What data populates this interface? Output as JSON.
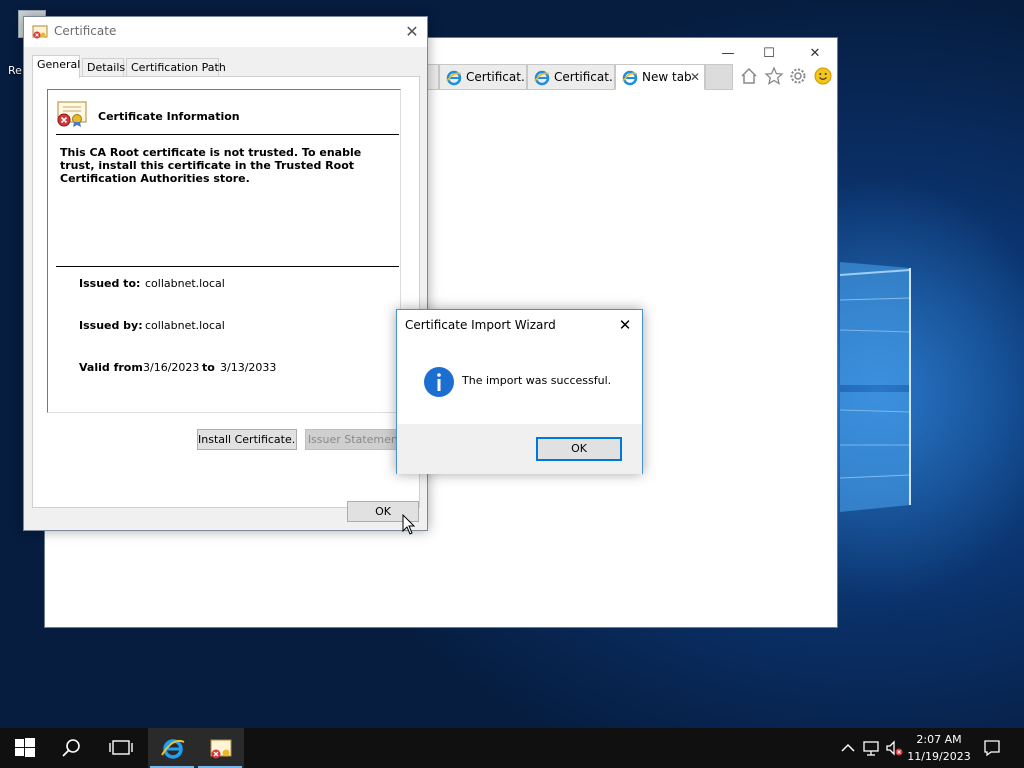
{
  "desktop": {
    "icon_label": "Re"
  },
  "browser": {
    "tabs": [
      {
        "label": "Certificat..."
      },
      {
        "label": "Certificat..."
      },
      {
        "label": "New tab",
        "close": "✕"
      }
    ],
    "caption": {
      "minimize": "—",
      "maximize": "☐",
      "close": "✕"
    }
  },
  "cert_dialog": {
    "title": "Certificate",
    "close": "✕",
    "tabs": [
      "General",
      "Details",
      "Certification Path"
    ],
    "info_title": "Certificate Information",
    "warning": "This CA Root certificate is not trusted. To enable trust, install this certificate in the Trusted Root Certification Authorities store.",
    "issued_to_label": "Issued to:",
    "issued_to": "collabnet.local",
    "issued_by_label": "Issued by:",
    "issued_by": "collabnet.local",
    "valid_from_label": "Valid from",
    "valid_from": "3/16/2023",
    "valid_to_label": "to",
    "valid_to": "3/13/2033",
    "install_button": "Install Certificate...",
    "issuer_button": "Issuer Statement",
    "ok_button": "OK"
  },
  "wizard": {
    "title": "Certificate Import Wizard",
    "close": "✕",
    "message": "The import was successful.",
    "ok_button": "OK"
  },
  "taskbar": {
    "time": "2:07 AM",
    "date": "11/19/2023"
  }
}
